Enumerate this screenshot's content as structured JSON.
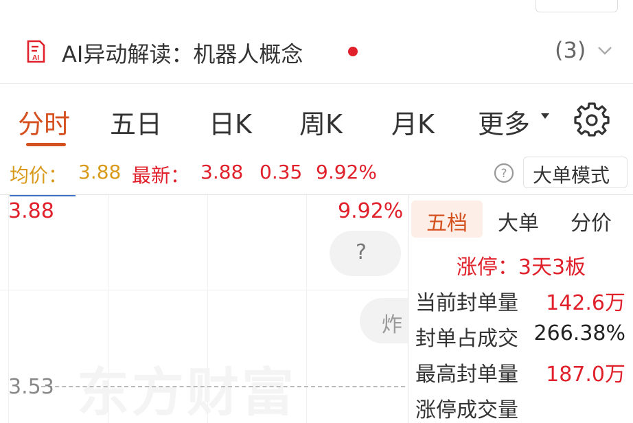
{
  "ai_bar": {
    "text": "AI异动解读：机器人概念",
    "count": "(3)"
  },
  "tabs": [
    "分时",
    "五日",
    "日K",
    "周K",
    "月K",
    "更多"
  ],
  "info": {
    "avg_label": "均价：",
    "avg_value": "3.88",
    "latest_label": "最新：",
    "latest_value": "3.88",
    "change": "0.35",
    "change_pct": "9.92%",
    "mode_button": "大单模式"
  },
  "chart": {
    "price_top": "3.88",
    "pct_top": "9.92%",
    "price_bottom": "3.53",
    "watermark": "东方财富",
    "bubble_question": "?",
    "bubble_zha": "炸"
  },
  "panel": {
    "tabs": [
      "五档",
      "大单",
      "分价"
    ],
    "limit_title": "涨停：3天3板",
    "rows": [
      {
        "label": "当前封单量",
        "value": "142.6万"
      },
      {
        "label": "封单占成交",
        "value": "266.38%"
      },
      {
        "label": "最高封单量",
        "value": "187.0万"
      },
      {
        "label": "涨停成交量",
        "value": ""
      }
    ]
  },
  "colors": {
    "accent": "#d5501f",
    "up_red": "#e0202a",
    "avg_gold": "#d99a1b"
  }
}
